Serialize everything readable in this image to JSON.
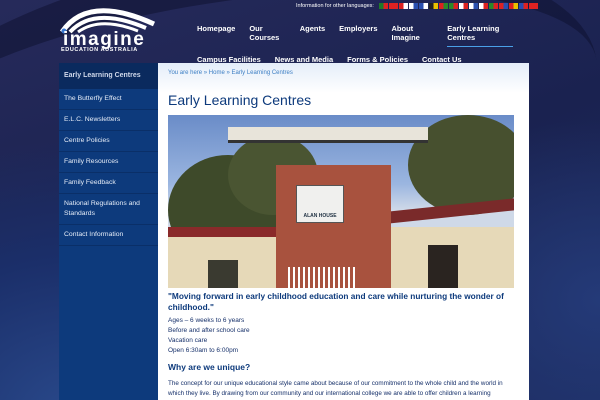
{
  "brand": {
    "name": "imagine",
    "tagline": "EDUCATION AUSTRALIA"
  },
  "languages": {
    "label": "Information for other languages:",
    "flags": [
      [
        "#1f7a2a",
        "#d22"
      ],
      [
        "#d22",
        "#d22"
      ],
      [
        "#d22",
        "#fff"
      ],
      [
        "#fff",
        "#2a4fb0"
      ],
      [
        "#2a4fb0",
        "#fff"
      ],
      [
        "#222",
        "#e8c200"
      ],
      [
        "#d22",
        "#2a8a2a"
      ],
      [
        "#2a8a2a",
        "#d22"
      ],
      [
        "#fff",
        "#d22"
      ],
      [
        "#fff",
        "#2a4fb0"
      ],
      [
        "#fff",
        "#d22"
      ],
      [
        "#2a8a2a",
        "#d22"
      ],
      [
        "#d22",
        "#2a4fb0"
      ],
      [
        "#d22",
        "#e8c200"
      ],
      [
        "#2a4fb0",
        "#d22"
      ],
      [
        "#d22",
        "#d22"
      ]
    ]
  },
  "nav": {
    "row1": [
      "Homepage",
      "Our Courses",
      "Agents",
      "Employers",
      "About Imagine",
      "Early Learning Centres"
    ],
    "row2": [
      "Campus Facilities",
      "News and Media",
      "Forms & Policies",
      "Contact Us"
    ],
    "active": "Early Learning Centres"
  },
  "sidebar": {
    "heading": "Early Learning Centres",
    "items": [
      "The Butterfly Effect",
      "E.L.C. Newsletters",
      "Centre Policies",
      "Family Resources",
      "Family Feedback",
      "National Regulations and Standards",
      "Contact Information"
    ]
  },
  "breadcrumb": "You are here » Home » Early Learning Centres",
  "page_title": "Early Learning Centres",
  "photo_sign": "ALAN HOUSE",
  "quote": "\"Moving forward in early childhood education and care while nurturing the wonder of childhood.\"",
  "facts": [
    "Ages – 6 weeks to 6 years",
    "Before and after school care",
    "Vacation care",
    "Open 6:30am to 6:00pm"
  ],
  "unique_heading": "Why are we unique?",
  "unique_text": "The concept for our unique educational style came about because of our commitment to the whole child and the world in which they live. By drawing from our community and our international college we are able to offer children a learning"
}
